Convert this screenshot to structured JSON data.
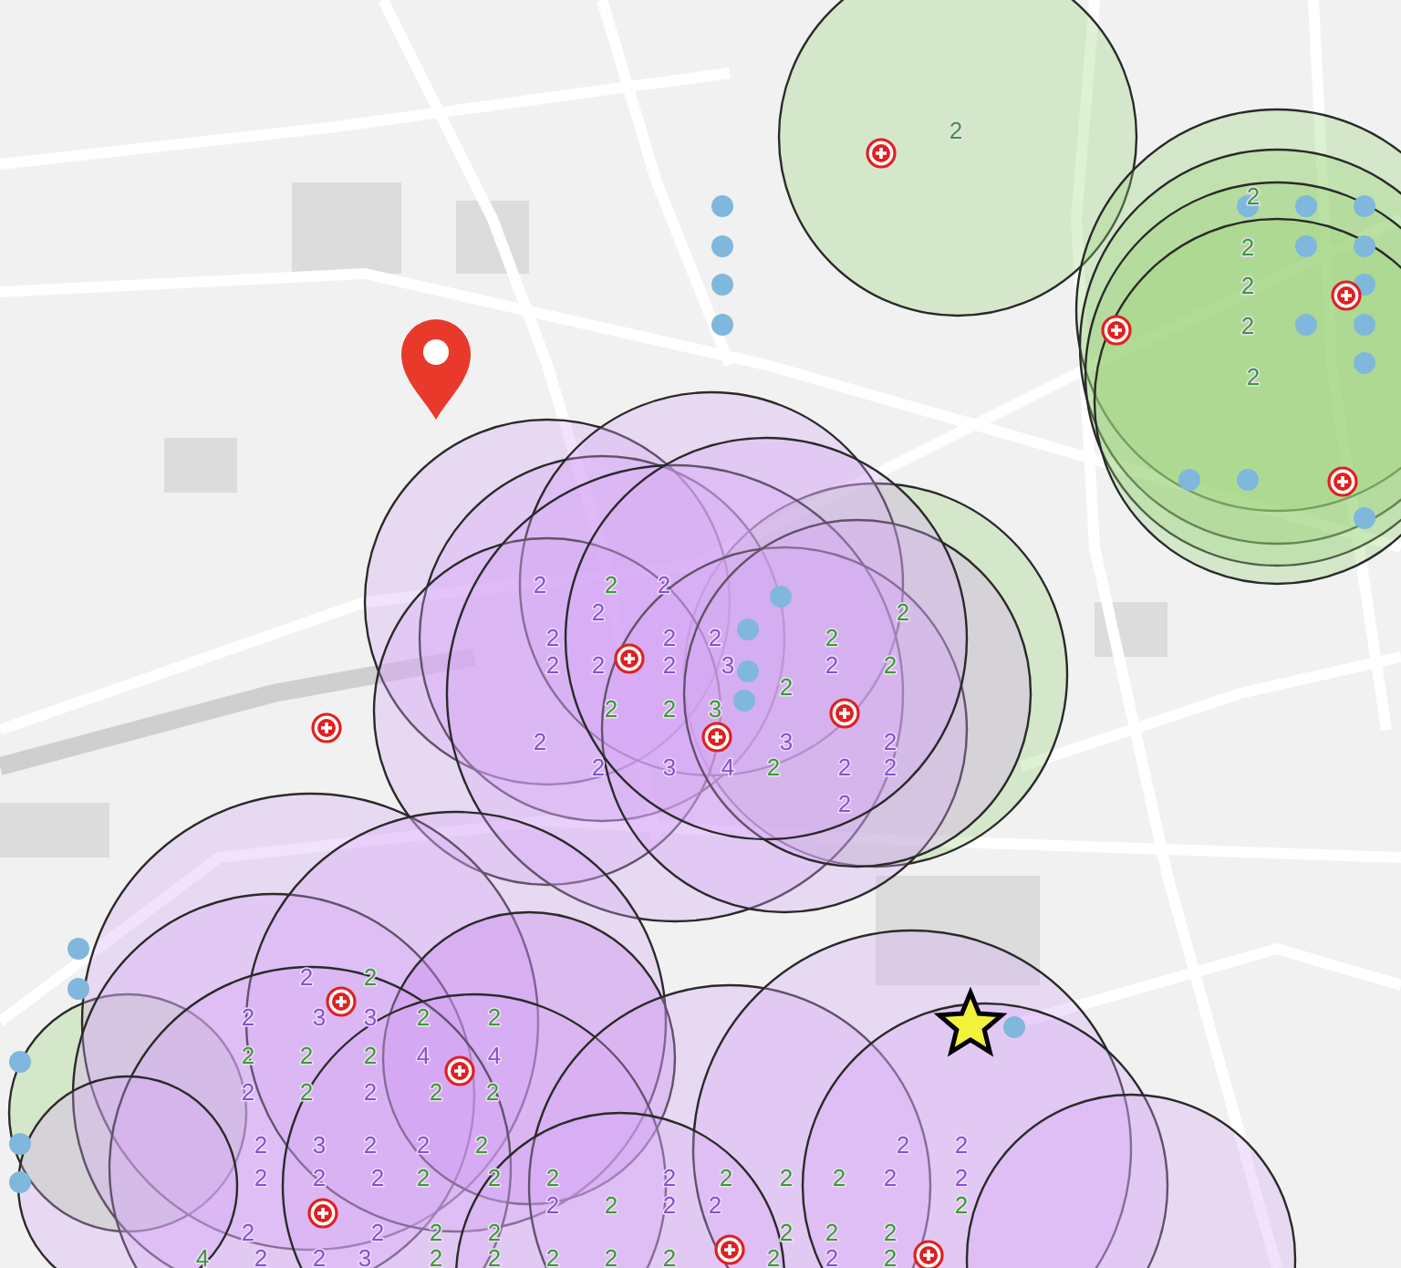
{
  "map": {
    "circles": [
      {
        "kind": "green"
      },
      {
        "kind": "green"
      },
      {
        "kind": "green"
      },
      {
        "kind": "green"
      },
      {
        "kind": "green"
      },
      {
        "kind": "green"
      },
      {
        "kind": "green"
      },
      {
        "kind": "purple"
      },
      {
        "kind": "purple"
      },
      {
        "kind": "purple"
      },
      {
        "kind": "purple"
      },
      {
        "kind": "purple"
      },
      {
        "kind": "purple"
      },
      {
        "kind": "purple"
      },
      {
        "kind": "purple"
      },
      {
        "kind": "purple"
      },
      {
        "kind": "purple"
      },
      {
        "kind": "purple"
      },
      {
        "kind": "dense"
      },
      {
        "kind": "purple"
      },
      {
        "kind": "purple"
      },
      {
        "kind": "purple"
      },
      {
        "kind": "purple"
      },
      {
        "kind": "purple"
      },
      {
        "kind": "purple"
      },
      {
        "kind": "purple"
      },
      {
        "kind": "purple"
      }
    ],
    "count_labels": [
      {
        "text": "2",
        "color": "#3a9a30"
      },
      {
        "text": "2",
        "color": "#3a9a30"
      },
      {
        "text": "2",
        "color": "#3a9a30"
      },
      {
        "text": "2",
        "color": "#3a9a30"
      },
      {
        "text": "2",
        "color": "#3a9a30"
      },
      {
        "text": "2",
        "color": "#3a9a30"
      },
      {
        "text": "2",
        "color": "#8a4fd8"
      },
      {
        "text": "2",
        "color": "#3a9a30"
      },
      {
        "text": "2",
        "color": "#8a4fd8"
      },
      {
        "text": "2",
        "color": "#8a4fd8"
      },
      {
        "text": "2",
        "color": "#3a9a30"
      },
      {
        "text": "2",
        "color": "#8a4fd8"
      },
      {
        "text": "2",
        "color": "#8a4fd8"
      },
      {
        "text": "2",
        "color": "#8a4fd8"
      },
      {
        "text": "2",
        "color": "#3a9a30"
      },
      {
        "text": "2",
        "color": "#8a4fd8"
      },
      {
        "text": "2",
        "color": "#8a4fd8"
      },
      {
        "text": "2",
        "color": "#8a4fd8"
      },
      {
        "text": "3",
        "color": "#8a4fd8"
      },
      {
        "text": "2",
        "color": "#8a4fd8"
      },
      {
        "text": "2",
        "color": "#3a9a30"
      },
      {
        "text": "2",
        "color": "#3a9a30"
      },
      {
        "text": "2",
        "color": "#3a9a30"
      },
      {
        "text": "2",
        "color": "#3a9a30"
      },
      {
        "text": "3",
        "color": "#3a9a30"
      },
      {
        "text": "2",
        "color": "#8a4fd8"
      },
      {
        "text": "3",
        "color": "#8a4fd8"
      },
      {
        "text": "2",
        "color": "#8a4fd8"
      },
      {
        "text": "2",
        "color": "#8a4fd8"
      },
      {
        "text": "3",
        "color": "#8a4fd8"
      },
      {
        "text": "4",
        "color": "#8a4fd8"
      },
      {
        "text": "2",
        "color": "#3a9a30"
      },
      {
        "text": "2",
        "color": "#8a4fd8"
      },
      {
        "text": "2",
        "color": "#8a4fd8"
      },
      {
        "text": "2",
        "color": "#8a4fd8"
      },
      {
        "text": "2",
        "color": "#8a4fd8"
      },
      {
        "text": "2",
        "color": "#3a9a30"
      },
      {
        "text": "2",
        "color": "#8a4fd8"
      },
      {
        "text": "3",
        "color": "#8a4fd8"
      },
      {
        "text": "3",
        "color": "#8a4fd8"
      },
      {
        "text": "2",
        "color": "#3a9a30"
      },
      {
        "text": "2",
        "color": "#3a9a30"
      },
      {
        "text": "2",
        "color": "#3a9a30"
      },
      {
        "text": "2",
        "color": "#3a9a30"
      },
      {
        "text": "2",
        "color": "#3a9a30"
      },
      {
        "text": "4",
        "color": "#8a4fd8"
      },
      {
        "text": "4",
        "color": "#8a4fd8"
      },
      {
        "text": "2",
        "color": "#8a4fd8"
      },
      {
        "text": "2",
        "color": "#3a9a30"
      },
      {
        "text": "2",
        "color": "#8a4fd8"
      },
      {
        "text": "2",
        "color": "#3a9a30"
      },
      {
        "text": "2",
        "color": "#3a9a30"
      },
      {
        "text": "2",
        "color": "#8a4fd8"
      },
      {
        "text": "3",
        "color": "#8a4fd8"
      },
      {
        "text": "2",
        "color": "#8a4fd8"
      },
      {
        "text": "2",
        "color": "#8a4fd8"
      },
      {
        "text": "2",
        "color": "#3a9a30"
      },
      {
        "text": "2",
        "color": "#8a4fd8"
      },
      {
        "text": "2",
        "color": "#8a4fd8"
      },
      {
        "text": "2",
        "color": "#8a4fd8"
      },
      {
        "text": "2",
        "color": "#8a4fd8"
      },
      {
        "text": "2",
        "color": "#8a4fd8"
      },
      {
        "text": "2",
        "color": "#3a9a30"
      },
      {
        "text": "2",
        "color": "#3a9a30"
      },
      {
        "text": "2",
        "color": "#3a9a30"
      },
      {
        "text": "2",
        "color": "#8a4fd8"
      },
      {
        "text": "2",
        "color": "#3a9a30"
      },
      {
        "text": "2",
        "color": "#3a9a30"
      },
      {
        "text": "2",
        "color": "#3a9a30"
      },
      {
        "text": "2",
        "color": "#8a4fd8"
      },
      {
        "text": "2",
        "color": "#8a4fd8"
      },
      {
        "text": "2",
        "color": "#8a4fd8"
      },
      {
        "text": "2",
        "color": "#3a9a30"
      },
      {
        "text": "2",
        "color": "#8a4fd8"
      },
      {
        "text": "2",
        "color": "#8a4fd8"
      },
      {
        "text": "2",
        "color": "#3a9a30"
      },
      {
        "text": "2",
        "color": "#8a4fd8"
      },
      {
        "text": "2",
        "color": "#8a4fd8"
      },
      {
        "text": "2",
        "color": "#3a9a30"
      },
      {
        "text": "2",
        "color": "#3a9a30"
      },
      {
        "text": "2",
        "color": "#3a9a30"
      },
      {
        "text": "2",
        "color": "#3a9a30"
      },
      {
        "text": "2",
        "color": "#3a9a30"
      },
      {
        "text": "4",
        "color": "#3a9a30"
      },
      {
        "text": "2",
        "color": "#8a4fd8"
      },
      {
        "text": "2",
        "color": "#8a4fd8"
      },
      {
        "text": "3",
        "color": "#8a4fd8"
      },
      {
        "text": "2",
        "color": "#3a9a30"
      },
      {
        "text": "2",
        "color": "#3a9a30"
      },
      {
        "text": "2",
        "color": "#3a9a30"
      },
      {
        "text": "2",
        "color": "#3a9a30"
      },
      {
        "text": "2",
        "color": "#3a9a30"
      },
      {
        "text": "2",
        "color": "#3a9a30"
      },
      {
        "text": "2",
        "color": "#8a4fd8"
      },
      {
        "text": "2",
        "color": "#3a9a30"
      }
    ]
  }
}
